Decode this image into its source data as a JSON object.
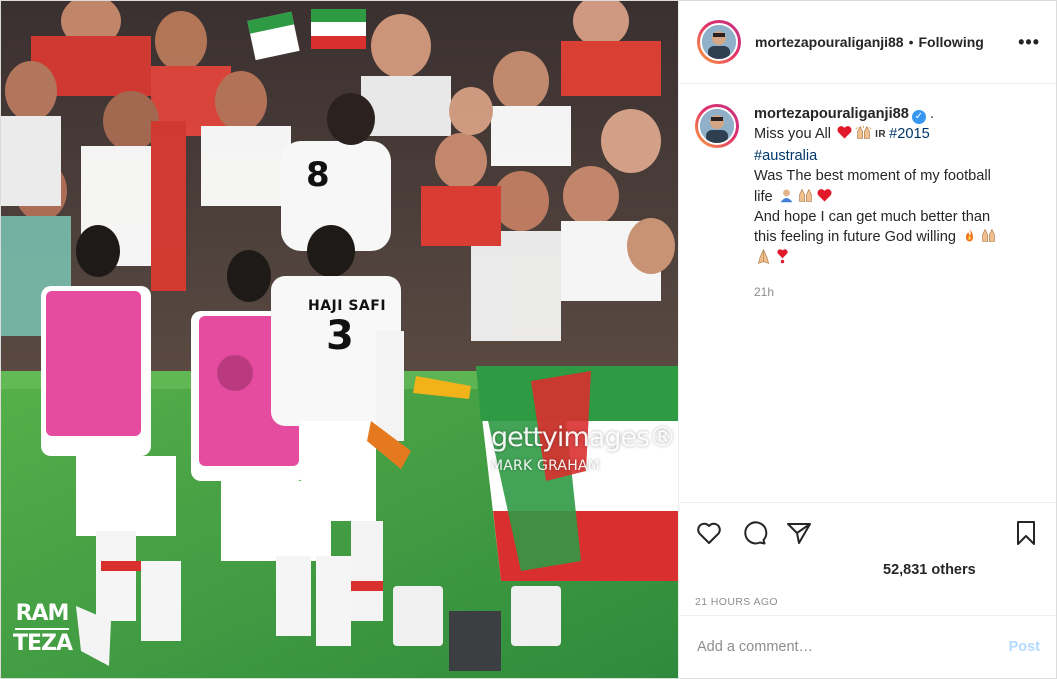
{
  "post": {
    "username": "mortezapouraliganji88",
    "dot": "•",
    "following_label": "Following",
    "more_icon": "more-horizontal-icon",
    "verified_icon": "verified-badge-icon",
    "verified_glyph": "✓"
  },
  "photo": {
    "watermark_main": "gettyimages®",
    "watermark_sub": "MARK GRAHAM",
    "logo_top": "RAM",
    "logo_bottom": "TEZA",
    "jersey_name": "HAJI SAFI",
    "jersey_number": "3"
  },
  "caption": {
    "after_name": " .",
    "line1_text": "Miss you All ",
    "line1_flag": "IR",
    "line1_tag": "#2015",
    "line2_tag": "#australia",
    "line3": "Was The best moment of my football",
    "line4": "life ",
    "line5": "And hope I can get much better than",
    "line6": "this feeling in future God willing ",
    "time_ago": "21h",
    "emojis": [
      "red-heart",
      "raising-hands",
      "person-bowing",
      "raising-hands",
      "red-heart",
      "fire",
      "raising-hands",
      "folded-hands",
      "heart-exclamation"
    ]
  },
  "actions": {
    "like_icon": "heart-outline-icon",
    "comment_icon": "comment-bubble-icon",
    "share_icon": "paper-plane-icon",
    "save_icon": "bookmark-icon"
  },
  "likes_text": "52,831 others",
  "post_time": "21 HOURS AGO",
  "comment_box": {
    "placeholder": "Add a comment…",
    "post_label": "Post"
  },
  "colors": {
    "accent_link": "#00376b",
    "post_button": "#b3dbff",
    "verified": "#3897f0",
    "secondary_text": "#8e8e8e"
  }
}
